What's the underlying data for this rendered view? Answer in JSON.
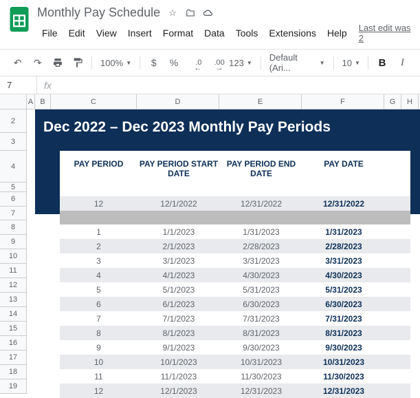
{
  "doc": {
    "title": "Monthly Pay Schedule"
  },
  "menu": {
    "file": "File",
    "edit": "Edit",
    "view": "View",
    "insert": "Insert",
    "format": "Format",
    "data": "Data",
    "tools": "Tools",
    "extensions": "Extensions",
    "help": "Help",
    "lastEdit": "Last edit was 2"
  },
  "toolbar": {
    "zoom": "100%",
    "dollar": "$",
    "percent": "%",
    "dec0": ".0",
    "dec00": ".00",
    "numFormat": "123",
    "font": "Default (Ari...",
    "fontSize": "10"
  },
  "nameBox": "7",
  "fx": "fx",
  "colHeads": [
    "A",
    "B",
    "C",
    "D",
    "E",
    "F",
    "G",
    "H"
  ],
  "rowHeads": [
    "2",
    "3",
    "4",
    "5",
    "6",
    "7",
    "8",
    "9",
    "10",
    "11",
    "12",
    "13",
    "14",
    "15",
    "16",
    "17",
    "18",
    "19"
  ],
  "banner": {
    "title": "Dec 2022 – Dec 2023 Monthly Pay Periods"
  },
  "headers": {
    "h1": "PAY PERIOD",
    "h2": "PAY PERIOD START DATE",
    "h3": "PAY PERIOD END DATE",
    "h4": "PAY DATE"
  },
  "rows": [
    {
      "p": "12",
      "s": "12/1/2022",
      "e": "12/31/2022",
      "d": "12/31/2022"
    },
    {
      "p": "1",
      "s": "1/1/2023",
      "e": "1/31/2023",
      "d": "1/31/2023"
    },
    {
      "p": "2",
      "s": "2/1/2023",
      "e": "2/28/2023",
      "d": "2/28/2023"
    },
    {
      "p": "3",
      "s": "3/1/2023",
      "e": "3/31/2023",
      "d": "3/31/2023"
    },
    {
      "p": "4",
      "s": "4/1/2023",
      "e": "4/30/2023",
      "d": "4/30/2023"
    },
    {
      "p": "5",
      "s": "5/1/2023",
      "e": "5/31/2023",
      "d": "5/31/2023"
    },
    {
      "p": "6",
      "s": "6/1/2023",
      "e": "6/30/2023",
      "d": "6/30/2023"
    },
    {
      "p": "7",
      "s": "7/1/2023",
      "e": "7/31/2023",
      "d": "7/31/2023"
    },
    {
      "p": "8",
      "s": "8/1/2023",
      "e": "8/31/2023",
      "d": "8/31/2023"
    },
    {
      "p": "9",
      "s": "9/1/2023",
      "e": "9/30/2023",
      "d": "9/30/2023"
    },
    {
      "p": "10",
      "s": "10/1/2023",
      "e": "10/31/2023",
      "d": "10/31/2023"
    },
    {
      "p": "11",
      "s": "11/1/2023",
      "e": "11/30/2023",
      "d": "11/30/2023"
    },
    {
      "p": "12",
      "s": "12/1/2023",
      "e": "12/31/2023",
      "d": "12/31/2023"
    }
  ]
}
